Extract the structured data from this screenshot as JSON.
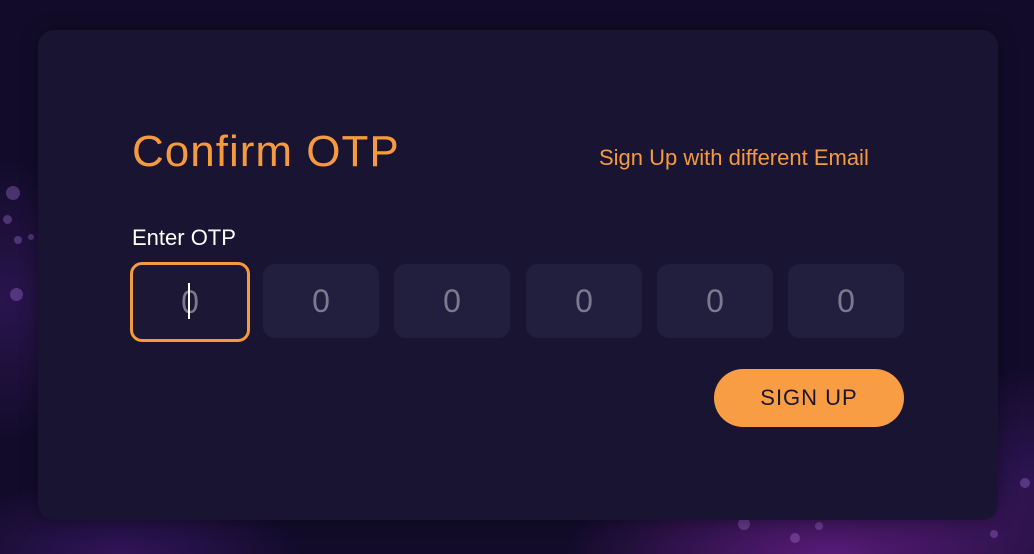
{
  "colors": {
    "accent": "#f59a3f",
    "button": "#f89d43",
    "card_background": "#191431",
    "input_background": "#221e3d",
    "label": "#ffffff"
  },
  "form": {
    "title": "Confirm OTP",
    "alt_link": "Sign Up with different Email",
    "otp_label": "Enter OTP",
    "otp_boxes": [
      {
        "value": "",
        "placeholder": "0",
        "focused": true
      },
      {
        "value": "",
        "placeholder": "0",
        "focused": false
      },
      {
        "value": "",
        "placeholder": "0",
        "focused": false
      },
      {
        "value": "",
        "placeholder": "0",
        "focused": false
      },
      {
        "value": "",
        "placeholder": "0",
        "focused": false
      },
      {
        "value": "",
        "placeholder": "0",
        "focused": false
      }
    ],
    "submit_label": "SIGN UP"
  }
}
